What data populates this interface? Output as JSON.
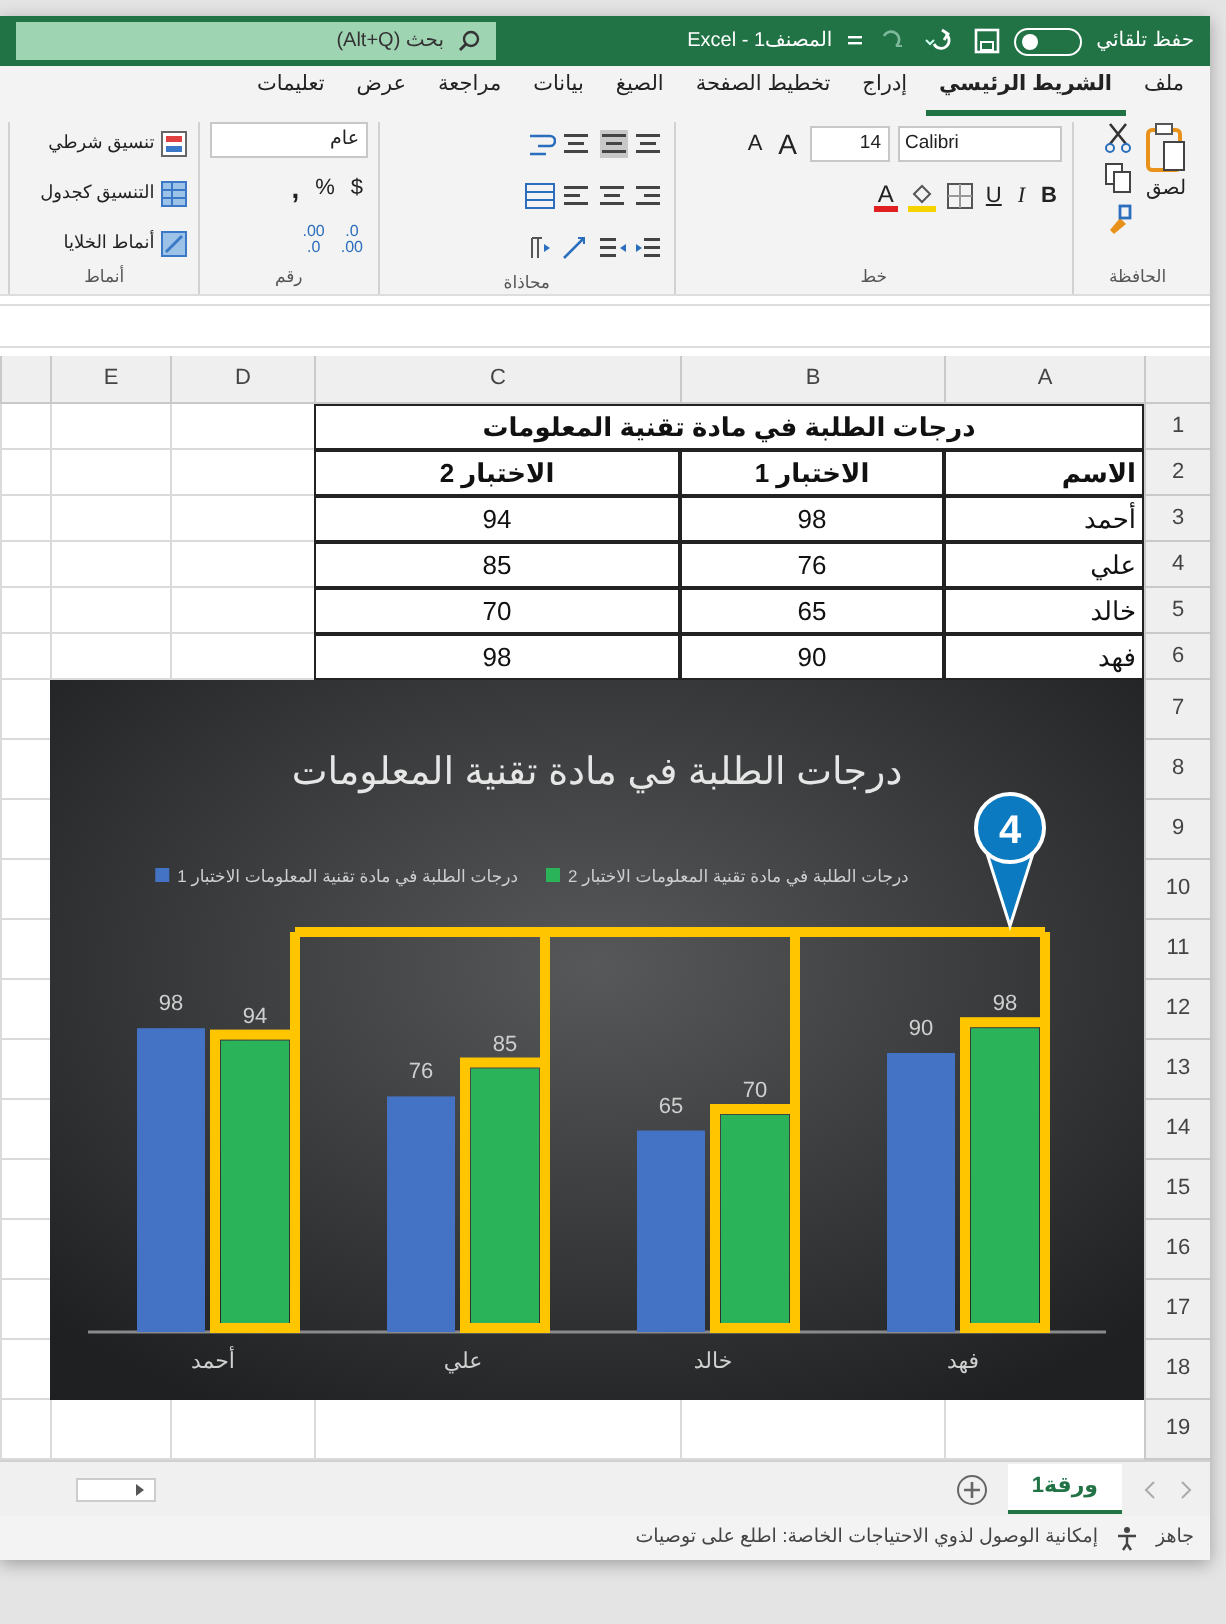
{
  "title_bar": {
    "autosave": {
      "label": "حفظ تلقائي",
      "on": false
    },
    "title": "المصنف1 - Excel",
    "search": {
      "placeholder": "بحث (Alt+Q)"
    }
  },
  "tabs": [
    {
      "label": "ملف",
      "selected": false
    },
    {
      "label": "الشريط الرئيسي",
      "selected": true
    },
    {
      "label": "إدراج",
      "selected": false
    },
    {
      "label": "تخطيط الصفحة",
      "selected": false
    },
    {
      "label": "الصيغ",
      "selected": false
    },
    {
      "label": "بيانات",
      "selected": false
    },
    {
      "label": "مراجعة",
      "selected": false
    },
    {
      "label": "عرض",
      "selected": false
    },
    {
      "label": "تعليمات",
      "selected": false
    }
  ],
  "ribbon": {
    "clipboard": {
      "label": "الحافظة",
      "paste": "لصق"
    },
    "font": {
      "label": "خط",
      "name": "Calibri",
      "size": "14",
      "grow": "A",
      "shrink": "A",
      "bold": "B",
      "italic": "I",
      "underline": "U",
      "color_letter": "A"
    },
    "alignment": {
      "label": "محاذاة"
    },
    "number": {
      "label": "رقم",
      "format": "عام",
      "currency": "$",
      "percent": "%",
      "comma": ",",
      "decimals": [
        {
          "top": ".0",
          "bottom": ".00"
        },
        {
          "top": ".00",
          "bottom": ".0"
        }
      ]
    },
    "styles": {
      "label": "أنماط",
      "items": [
        "تنسيق شرطي",
        "التنسيق كجدول",
        "أنماط الخلايا"
      ]
    }
  },
  "sheet": {
    "columns": [
      "A",
      "B",
      "C",
      "D",
      "E"
    ],
    "rows": [
      "1",
      "2",
      "3",
      "4",
      "5",
      "6",
      "7",
      "8",
      "9",
      "10",
      "11",
      "12",
      "13",
      "14",
      "15",
      "16",
      "17",
      "18",
      "19"
    ],
    "title": "درجات الطلبة في مادة تقنية المعلومات",
    "headers": [
      "الاسم",
      "الاختبار 1",
      "الاختبار 2"
    ],
    "data": [
      [
        "أحمد",
        "98",
        "94"
      ],
      [
        "علي",
        "76",
        "85"
      ],
      [
        "خالد",
        "65",
        "70"
      ],
      [
        "فهد",
        "90",
        "98"
      ]
    ]
  },
  "chart": {
    "callout": "4",
    "chart_data": {
      "type": "bar",
      "title": "درجات الطلبة في مادة تقنية المعلومات",
      "categories": [
        "أحمد",
        "علي",
        "خالد",
        "فهد"
      ],
      "data_labels": true,
      "legend": true,
      "series": [
        {
          "name": "درجات الطلبة في مادة تقنية المعلومات الاختبار 1",
          "color": "#4472c4",
          "values": [
            98,
            76,
            65,
            90
          ]
        },
        {
          "name": "درجات الطلبة في مادة تقنية المعلومات الاختبار 2",
          "color": "#2bb35a",
          "values": [
            94,
            85,
            70,
            98
          ]
        }
      ]
    }
  },
  "sheet_tabs": [
    {
      "label": "ورقة1",
      "selected": true
    }
  ],
  "status_bar": {
    "ready": "جاهز",
    "accessibility": "إمكانية الوصول لذوي الاحتياجات الخاصة: اطلع على توصيات"
  }
}
